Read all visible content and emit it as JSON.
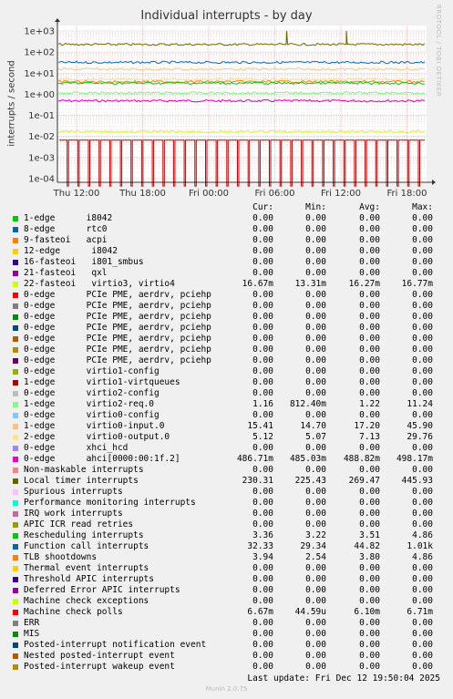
{
  "title": "Individual interrupts - by day",
  "ylabel": "interrupts / second",
  "side_text": "RRDTOOL / TOBI OETIKER",
  "chart_data": {
    "type": "line",
    "title": "Individual interrupts - by day",
    "ylabel": "interrupts / second",
    "yscale": "log",
    "ylim": [
      0.0001,
      1000
    ],
    "y_ticks": [
      "1e+03",
      "1e+02",
      "1e+01",
      "1e+00",
      "1e-01",
      "1e-02",
      "1e-03",
      "1e-04"
    ],
    "x_ticks": [
      "Thu 12:00",
      "Thu 18:00",
      "Fri 00:00",
      "Fri 06:00",
      "Fri 12:00",
      "Fri 18:00"
    ],
    "grid": true,
    "series": [
      {
        "name": "Machine check polls",
        "color": "#cc0000",
        "level_low": 4.45e-05,
        "level_high": 0.00671,
        "pattern": "periodic-pulse"
      },
      {
        "name": "ahci[0000:00:1f.2]",
        "color": "#cc00cc",
        "level": 0.487
      },
      {
        "name": "Local timer interrupts",
        "color": "#666600",
        "level": 230.31,
        "spikes": [
          {
            "x": "Fri 06:00",
            "y": 1010
          },
          {
            "x": "Fri 12:00",
            "y": 1010
          }
        ]
      },
      {
        "name": "Function call interrupts",
        "color": "#0066b3",
        "level": 32.33
      },
      {
        "name": "virtio0-input.0",
        "color": "#ffbe7d",
        "level": 15.41
      },
      {
        "name": "virtio0-output.0",
        "color": "#ffd98a",
        "level": 5.12
      },
      {
        "name": "TLB shootdowns",
        "color": "#ff8000",
        "level": 3.94
      },
      {
        "name": "Rescheduling interrupts",
        "color": "#00cc00",
        "level": 3.36
      },
      {
        "name": "virtio2-req.0",
        "color": "#7ded7d",
        "level": 1.16
      },
      {
        "name": "22-fasteoi",
        "color": "#ccff00",
        "level": 0.01667
      }
    ]
  },
  "legend": {
    "headers": {
      "cur": "Cur:",
      "min": "Min:",
      "avg": "Avg:",
      "max": "Max:"
    },
    "rows": [
      {
        "color": "#00cc00",
        "label": "1-edge      i8042",
        "cur": "0.00",
        "min": "0.00",
        "avg": "0.00",
        "max": "0.00"
      },
      {
        "color": "#0066b3",
        "label": "8-edge      rtc0",
        "cur": "0.00",
        "min": "0.00",
        "avg": "0.00",
        "max": "0.00"
      },
      {
        "color": "#ff8000",
        "label": "9-fasteoi   acpi",
        "cur": "0.00",
        "min": "0.00",
        "avg": "0.00",
        "max": "0.00"
      },
      {
        "color": "#ffcc00",
        "label": "12-edge      i8042",
        "cur": "0.00",
        "min": "0.00",
        "avg": "0.00",
        "max": "0.00"
      },
      {
        "color": "#330099",
        "label": "16-fasteoi   i801_smbus",
        "cur": "0.00",
        "min": "0.00",
        "avg": "0.00",
        "max": "0.00"
      },
      {
        "color": "#990099",
        "label": "21-fasteoi   qxl",
        "cur": "0.00",
        "min": "0.00",
        "avg": "0.00",
        "max": "0.00"
      },
      {
        "color": "#ccff00",
        "label": "22-fasteoi   virtio3, virtio4",
        "cur": "16.67m",
        "min": "13.31m",
        "avg": "16.27m",
        "max": "16.77m"
      },
      {
        "color": "#ff0000",
        "label": "0-edge      PCIe PME, aerdrv, pciehp",
        "cur": "0.00",
        "min": "0.00",
        "avg": "0.00",
        "max": "0.00"
      },
      {
        "color": "#808080",
        "label": "0-edge      PCIe PME, aerdrv, pciehp",
        "cur": "0.00",
        "min": "0.00",
        "avg": "0.00",
        "max": "0.00"
      },
      {
        "color": "#008f00",
        "label": "0-edge      PCIe PME, aerdrv, pciehp",
        "cur": "0.00",
        "min": "0.00",
        "avg": "0.00",
        "max": "0.00"
      },
      {
        "color": "#00487d",
        "label": "0-edge      PCIe PME, aerdrv, pciehp",
        "cur": "0.00",
        "min": "0.00",
        "avg": "0.00",
        "max": "0.00"
      },
      {
        "color": "#b35a00",
        "label": "0-edge      PCIe PME, aerdrv, pciehp",
        "cur": "0.00",
        "min": "0.00",
        "avg": "0.00",
        "max": "0.00"
      },
      {
        "color": "#b38f00",
        "label": "0-edge      PCIe PME, aerdrv, pciehp",
        "cur": "0.00",
        "min": "0.00",
        "avg": "0.00",
        "max": "0.00"
      },
      {
        "color": "#6b006b",
        "label": "0-edge      PCIe PME, aerdrv, pciehp",
        "cur": "0.00",
        "min": "0.00",
        "avg": "0.00",
        "max": "0.00"
      },
      {
        "color": "#8fb300",
        "label": "0-edge      virtio1-config",
        "cur": "0.00",
        "min": "0.00",
        "avg": "0.00",
        "max": "0.00"
      },
      {
        "color": "#b30000",
        "label": "1-edge      virtio1-virtqueues",
        "cur": "0.00",
        "min": "0.00",
        "avg": "0.00",
        "max": "0.00"
      },
      {
        "color": "#bebebe",
        "label": "0-edge      virtio2-config",
        "cur": "0.00",
        "min": "0.00",
        "avg": "0.00",
        "max": "0.00"
      },
      {
        "color": "#80ff80",
        "label": "1-edge      virtio2-req.0",
        "cur": "1.16",
        "min": "812.40m",
        "avg": "1.22",
        "max": "11.24"
      },
      {
        "color": "#80c9ff",
        "label": "0-edge      virtio0-config",
        "cur": "0.00",
        "min": "0.00",
        "avg": "0.00",
        "max": "0.00"
      },
      {
        "color": "#ffc080",
        "label": "1-edge      virtio0-input.0",
        "cur": "15.41",
        "min": "14.70",
        "avg": "17.20",
        "max": "45.90"
      },
      {
        "color": "#ffe680",
        "label": "2-edge      virtio0-output.0",
        "cur": "5.12",
        "min": "5.07",
        "avg": "7.13",
        "max": "29.76"
      },
      {
        "color": "#aa80ff",
        "label": "0-edge      xhci_hcd",
        "cur": "0.00",
        "min": "0.00",
        "avg": "0.00",
        "max": "0.00"
      },
      {
        "color": "#ee00cc",
        "label": "0-edge      ahci[0000:00:1f.2]",
        "cur": "486.71m",
        "min": "485.03m",
        "avg": "488.82m",
        "max": "498.17m"
      },
      {
        "color": "#ff8080",
        "label": "Non-maskable interrupts",
        "cur": "0.00",
        "min": "0.00",
        "avg": "0.00",
        "max": "0.00"
      },
      {
        "color": "#666600",
        "label": "Local timer interrupts",
        "cur": "230.31",
        "min": "225.43",
        "avg": "269.47",
        "max": "445.93"
      },
      {
        "color": "#ffbfff",
        "label": "Spurious interrupts",
        "cur": "0.00",
        "min": "0.00",
        "avg": "0.00",
        "max": "0.00"
      },
      {
        "color": "#00ffcc",
        "label": "Performance monitoring interrupts",
        "cur": "0.00",
        "min": "0.00",
        "avg": "0.00",
        "max": "0.00"
      },
      {
        "color": "#cc6699",
        "label": "IRQ work interrupts",
        "cur": "0.00",
        "min": "0.00",
        "avg": "0.00",
        "max": "0.00"
      },
      {
        "color": "#999900",
        "label": "APIC ICR read retries",
        "cur": "0.00",
        "min": "0.00",
        "avg": "0.00",
        "max": "0.00"
      },
      {
        "color": "#00cc00",
        "label": "Rescheduling interrupts",
        "cur": "3.36",
        "min": "3.22",
        "avg": "3.51",
        "max": "4.86"
      },
      {
        "color": "#0066b3",
        "label": "Function call interrupts",
        "cur": "32.33",
        "min": "29.34",
        "avg": "44.82",
        "max": "1.01k"
      },
      {
        "color": "#ff8000",
        "label": "TLB shootdowns",
        "cur": "3.94",
        "min": "2.54",
        "avg": "3.80",
        "max": "4.86"
      },
      {
        "color": "#ffcc00",
        "label": "Thermal event interrupts",
        "cur": "0.00",
        "min": "0.00",
        "avg": "0.00",
        "max": "0.00"
      },
      {
        "color": "#330099",
        "label": "Threshold APIC interrupts",
        "cur": "0.00",
        "min": "0.00",
        "avg": "0.00",
        "max": "0.00"
      },
      {
        "color": "#990099",
        "label": "Deferred Error APIC interrupts",
        "cur": "0.00",
        "min": "0.00",
        "avg": "0.00",
        "max": "0.00"
      },
      {
        "color": "#ccff00",
        "label": "Machine check exceptions",
        "cur": "0.00",
        "min": "0.00",
        "avg": "0.00",
        "max": "0.00"
      },
      {
        "color": "#ff0000",
        "label": "Machine check polls",
        "cur": "6.67m",
        "min": "44.59u",
        "avg": "6.10m",
        "max": "6.71m"
      },
      {
        "color": "#808080",
        "label": "ERR",
        "cur": "0.00",
        "min": "0.00",
        "avg": "0.00",
        "max": "0.00"
      },
      {
        "color": "#008f00",
        "label": "MIS",
        "cur": "0.00",
        "min": "0.00",
        "avg": "0.00",
        "max": "0.00"
      },
      {
        "color": "#00487d",
        "label": "Posted-interrupt notification event",
        "cur": "0.00",
        "min": "0.00",
        "avg": "0.00",
        "max": "0.00"
      },
      {
        "color": "#b35a00",
        "label": "Nested posted-interrupt event",
        "cur": "0.00",
        "min": "0.00",
        "avg": "0.00",
        "max": "0.00"
      },
      {
        "color": "#b38f00",
        "label": "Posted-interrupt wakeup event",
        "cur": "0.00",
        "min": "0.00",
        "avg": "0.00",
        "max": "0.00"
      }
    ]
  },
  "footer": "Last update: Fri Dec 12 19:50:04 2025",
  "munin": "Munin 2.0.75"
}
